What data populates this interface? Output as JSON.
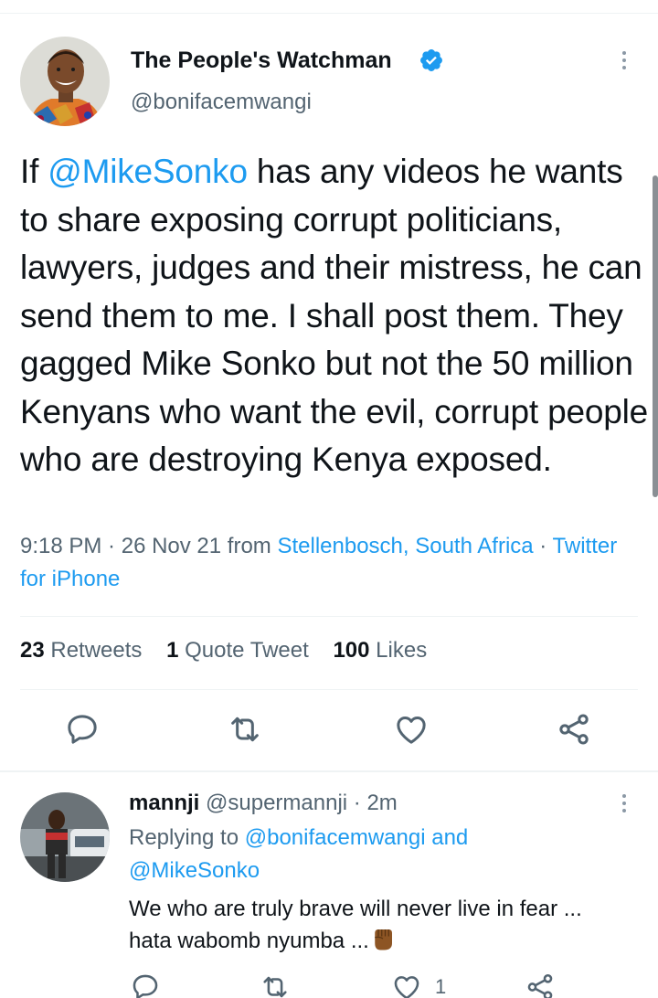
{
  "tweet": {
    "author_name": "The People's Watchman",
    "handle": "@bonifacemwangi",
    "verified": true,
    "text_prefix": "If ",
    "mention": "@MikeSonko",
    "text_suffix": " has any videos he wants to share exposing corrupt politicians, lawyers, judges and their mistress, he can send them to me. I shall post them. They gagged Mike Sonko but not the 50 million Kenyans who want the evil, corrupt people who are destroying Kenya exposed.",
    "time": "9:18 PM",
    "date": "26 Nov 21",
    "from_label": "from",
    "location": "Stellenbosch, South Africa",
    "source": "Twitter for iPhone",
    "stats": {
      "retweets_count": "23",
      "retweets_label": "Retweets",
      "quotes_count": "1",
      "quotes_label": "Quote Tweet",
      "likes_count": "100",
      "likes_label": "Likes"
    },
    "actions": [
      "reply-icon",
      "retweet-icon",
      "like-icon",
      "share-icon"
    ]
  },
  "reply": {
    "name": "mannji",
    "handle": "@supermannji",
    "time": "2m",
    "replying_label": "Replying to",
    "replying_to_1": "@bonifacemwangi",
    "and_label": "and",
    "replying_to_2": "@MikeSonko",
    "line1": "We who are truly brave will never live in fear ...",
    "line2": "hata wabomb nyumba ...",
    "like_count": "1"
  },
  "colors": {
    "accent": "#1d9bf0",
    "text": "#0f1419",
    "secondary": "#536471"
  }
}
